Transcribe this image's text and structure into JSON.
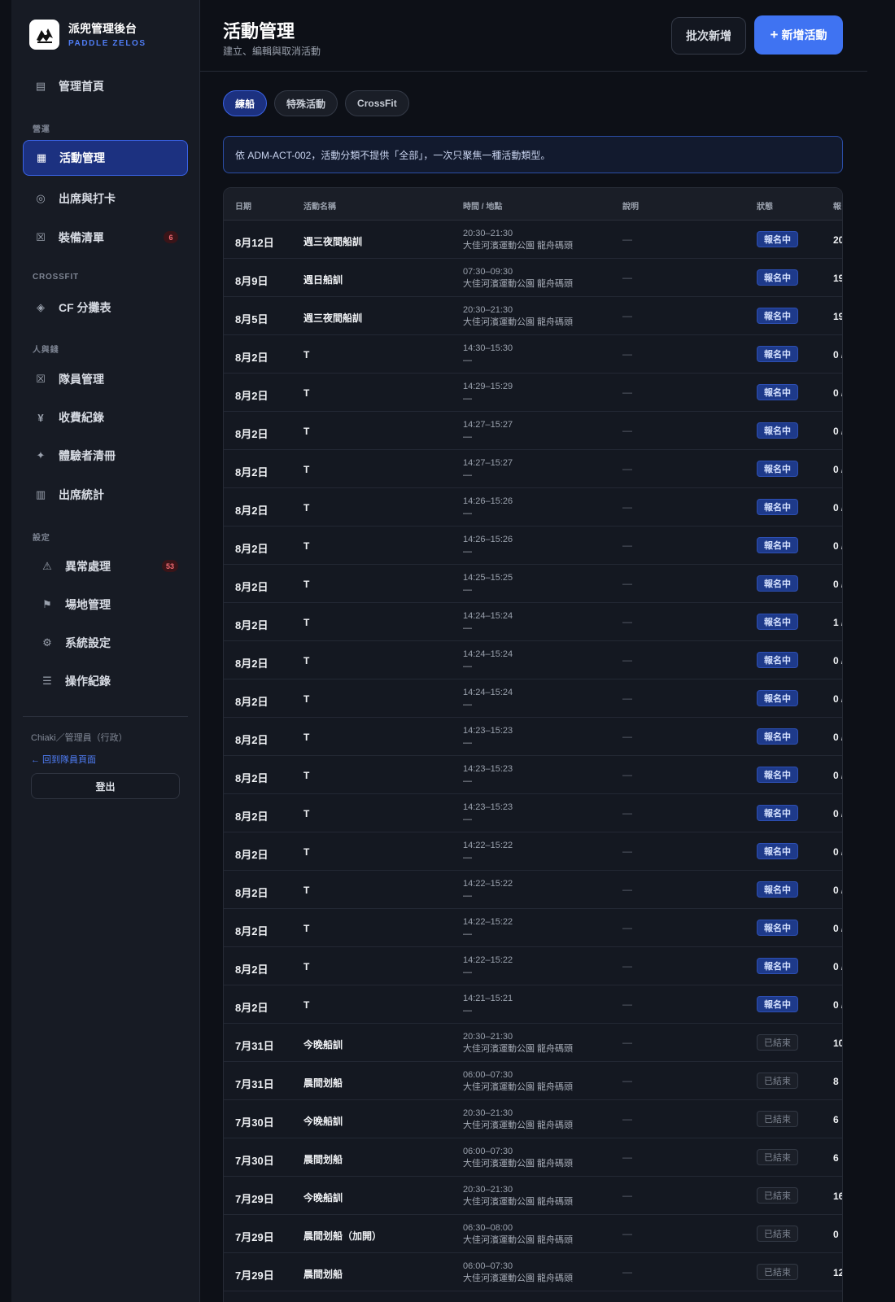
{
  "sidebar": {
    "brand_title": "派兜管理後台",
    "brand_subtitle": "PADDLE ZELOS",
    "home": {
      "label": "管理首頁",
      "icon": "list-icon"
    },
    "section_ops": "營運",
    "activities": {
      "label": "活動管理",
      "icon": "grid-icon"
    },
    "attendance": {
      "label": "出席與打卡",
      "icon": "target-icon"
    },
    "equipment": {
      "label": "裝備清單",
      "icon": "box-icon",
      "badge": "6"
    },
    "section_crossfit": "CROSSFIT",
    "cf_groups": {
      "label": "CF 分攤表",
      "icon": "diamond-icon"
    },
    "section_people": "人與錢",
    "members": {
      "label": "隊員管理",
      "icon": "box-icon"
    },
    "payments": {
      "label": "收費紀錄",
      "icon": "yen-icon"
    },
    "trial": {
      "label": "體驗者清冊",
      "icon": "sparkle-icon"
    },
    "stats": {
      "label": "出席統計",
      "icon": "columns-icon"
    },
    "section_settings": "設定",
    "anomalies": {
      "label": "異常處理",
      "icon": "warning-icon",
      "badge": "53"
    },
    "venues": {
      "label": "場地管理",
      "icon": "flag-icon"
    },
    "system": {
      "label": "系統設定",
      "icon": "gear-icon"
    },
    "logs": {
      "label": "操作紀錄",
      "icon": "menu-icon"
    },
    "user": "Chiaki／管理員（行政）",
    "back_link": "← 回到隊員頁面",
    "logout": "登出"
  },
  "header": {
    "title": "活動管理",
    "subtitle": "建立、編輯與取消活動",
    "batch_button": "批次新增",
    "new_button": "新增活動",
    "new_icon": "+"
  },
  "tabs": [
    "練船",
    "特殊活動",
    "CrossFit"
  ],
  "active_tab": "練船",
  "notice": "依 ADM-ACT-002，活動分類不提供「全部」，一次只聚焦一種活動類型。",
  "table": {
    "columns": [
      "日期",
      "活動名稱",
      "時間 / 地點",
      "說明",
      "狀態",
      "報"
    ],
    "rows": [
      {
        "date": "8月12日",
        "name": "週三夜間船訓",
        "time": "20:30–21:30",
        "location": "大佳河濱運動公園 龍舟碼頭",
        "desc": "—",
        "status": "報名中",
        "count": "20"
      },
      {
        "date": "8月9日",
        "name": "週日船訓",
        "time": "07:30–09:30",
        "location": "大佳河濱運動公園 龍舟碼頭",
        "desc": "—",
        "status": "報名中",
        "count": "19"
      },
      {
        "date": "8月5日",
        "name": "週三夜間船訓",
        "time": "20:30–21:30",
        "location": "大佳河濱運動公園 龍舟碼頭",
        "desc": "—",
        "status": "報名中",
        "count": "19"
      },
      {
        "date": "8月2日",
        "name": "T",
        "time": "14:30–15:30",
        "location": "—",
        "desc": "—",
        "status": "報名中",
        "count": "0 /"
      },
      {
        "date": "8月2日",
        "name": "T",
        "time": "14:29–15:29",
        "location": "—",
        "desc": "—",
        "status": "報名中",
        "count": "0 /"
      },
      {
        "date": "8月2日",
        "name": "T",
        "time": "14:27–15:27",
        "location": "—",
        "desc": "—",
        "status": "報名中",
        "count": "0 /"
      },
      {
        "date": "8月2日",
        "name": "T",
        "time": "14:27–15:27",
        "location": "—",
        "desc": "—",
        "status": "報名中",
        "count": "0 /"
      },
      {
        "date": "8月2日",
        "name": "T",
        "time": "14:26–15:26",
        "location": "—",
        "desc": "—",
        "status": "報名中",
        "count": "0 /"
      },
      {
        "date": "8月2日",
        "name": "T",
        "time": "14:26–15:26",
        "location": "—",
        "desc": "—",
        "status": "報名中",
        "count": "0 /"
      },
      {
        "date": "8月2日",
        "name": "T",
        "time": "14:25–15:25",
        "location": "—",
        "desc": "—",
        "status": "報名中",
        "count": "0 /"
      },
      {
        "date": "8月2日",
        "name": "T",
        "time": "14:24–15:24",
        "location": "—",
        "desc": "—",
        "status": "報名中",
        "count": "1 /"
      },
      {
        "date": "8月2日",
        "name": "T",
        "time": "14:24–15:24",
        "location": "—",
        "desc": "—",
        "status": "報名中",
        "count": "0 /"
      },
      {
        "date": "8月2日",
        "name": "T",
        "time": "14:24–15:24",
        "location": "—",
        "desc": "—",
        "status": "報名中",
        "count": "0 /"
      },
      {
        "date": "8月2日",
        "name": "T",
        "time": "14:23–15:23",
        "location": "—",
        "desc": "—",
        "status": "報名中",
        "count": "0 /"
      },
      {
        "date": "8月2日",
        "name": "T",
        "time": "14:23–15:23",
        "location": "—",
        "desc": "—",
        "status": "報名中",
        "count": "0 /"
      },
      {
        "date": "8月2日",
        "name": "T",
        "time": "14:23–15:23",
        "location": "—",
        "desc": "—",
        "status": "報名中",
        "count": "0 /"
      },
      {
        "date": "8月2日",
        "name": "T",
        "time": "14:22–15:22",
        "location": "—",
        "desc": "—",
        "status": "報名中",
        "count": "0 /"
      },
      {
        "date": "8月2日",
        "name": "T",
        "time": "14:22–15:22",
        "location": "—",
        "desc": "—",
        "status": "報名中",
        "count": "0 /"
      },
      {
        "date": "8月2日",
        "name": "T",
        "time": "14:22–15:22",
        "location": "—",
        "desc": "—",
        "status": "報名中",
        "count": "0 /"
      },
      {
        "date": "8月2日",
        "name": "T",
        "time": "14:22–15:22",
        "location": "—",
        "desc": "—",
        "status": "報名中",
        "count": "0 /"
      },
      {
        "date": "8月2日",
        "name": "T",
        "time": "14:21–15:21",
        "location": "—",
        "desc": "—",
        "status": "報名中",
        "count": "0 /"
      },
      {
        "date": "7月31日",
        "name": "今晚船訓",
        "time": "20:30–21:30",
        "location": "大佳河濱運動公園 龍舟碼頭",
        "desc": "—",
        "status": "已結束",
        "count": "10"
      },
      {
        "date": "7月31日",
        "name": "晨間划船",
        "time": "06:00–07:30",
        "location": "大佳河濱運動公園 龍舟碼頭",
        "desc": "—",
        "status": "已結束",
        "count": "8"
      },
      {
        "date": "7月30日",
        "name": "今晚船訓",
        "time": "20:30–21:30",
        "location": "大佳河濱運動公園 龍舟碼頭",
        "desc": "—",
        "status": "已結束",
        "count": "6"
      },
      {
        "date": "7月30日",
        "name": "晨間划船",
        "time": "06:00–07:30",
        "location": "大佳河濱運動公園 龍舟碼頭",
        "desc": "—",
        "status": "已結束",
        "count": "6"
      },
      {
        "date": "7月29日",
        "name": "今晚船訓",
        "time": "20:30–21:30",
        "location": "大佳河濱運動公園 龍舟碼頭",
        "desc": "—",
        "status": "已結束",
        "count": "16"
      },
      {
        "date": "7月29日",
        "name": "晨間划船（加開）",
        "time": "06:30–08:00",
        "location": "大佳河濱運動公園 龍舟碼頭",
        "desc": "—",
        "status": "已結束",
        "count": "0"
      },
      {
        "date": "7月29日",
        "name": "晨間划船",
        "time": "06:00–07:30",
        "location": "大佳河濱運動公園 龍舟碼頭",
        "desc": "—",
        "status": "已結束",
        "count": "12"
      }
    ]
  },
  "colors": {
    "background": "#0d1017",
    "sidebar": "#171b24",
    "accent": "#3f73f2",
    "active_nav": "#1c3180",
    "badge_text": "#f26b73",
    "status_open": "#1e3a8a",
    "status_ended": "#1b1f28"
  }
}
